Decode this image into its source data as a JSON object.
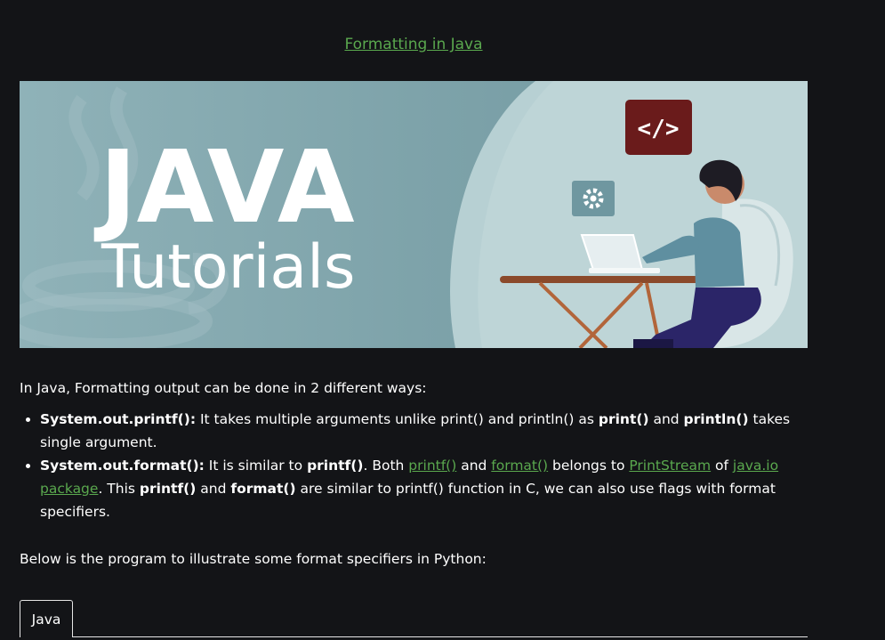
{
  "article": {
    "title_link": "Formatting in Java",
    "banner": {
      "headline": "JAVA",
      "subline": "Tutorials",
      "code_badge": "</>"
    },
    "intro": "In Java, Formatting output can be done in 2 different ways:",
    "ways": [
      {
        "name": "System.out.printf():",
        "t1": " It takes multiple arguments unlike print() and println() as ",
        "b1": "print()",
        "t2": " and ",
        "b2": "println()",
        "t3": " takes single argument."
      },
      {
        "name": "System.out.format():",
        "t1": " It is similar to ",
        "b1": "printf()",
        "t2": ". Both ",
        "link1": "printf()",
        "t3": " and ",
        "link2": "format()",
        "t4": " belongs to ",
        "link3": "PrintStream",
        "t5": " of ",
        "link4": "java.io package",
        "t6": ". This ",
        "b2": "printf()",
        "t7": " and ",
        "b3": "format()",
        "t8": " are similar to printf() function in C, we can also use flags with format specifiers."
      }
    ],
    "below": "Below is the program to illustrate some format specifiers in Python:",
    "code_tab": "Java"
  },
  "colors": {
    "background": "#131417",
    "link": "#5aa84e",
    "banner_bg": "#8fb2b8",
    "badge": "#6a1b1b"
  }
}
